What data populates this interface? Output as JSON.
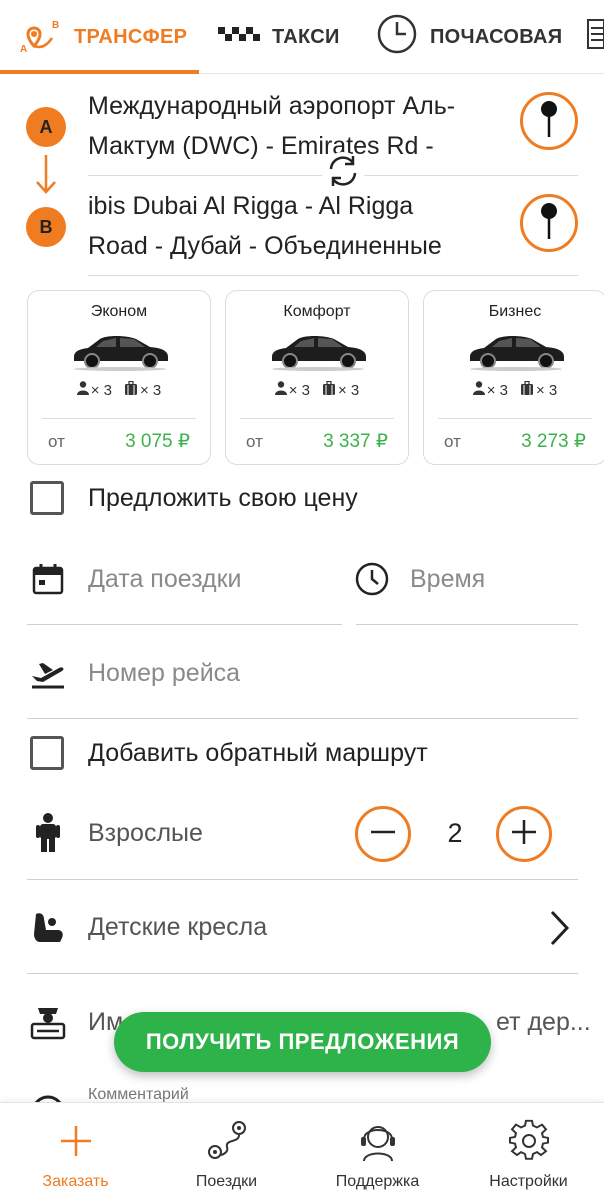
{
  "tabs": [
    {
      "label": "ТРАНСФЕР",
      "icon": "route-ab-icon",
      "active": true
    },
    {
      "label": "ТАКСИ",
      "icon": "checkered-taxi-icon",
      "active": false
    },
    {
      "label": "ПОЧАСОВАЯ",
      "icon": "clock-icon",
      "active": false
    }
  ],
  "route": {
    "from_marker": "A",
    "to_marker": "B",
    "from_line1": "Международный аэропорт Аль-",
    "from_line2": "Мактум (DWC) - Emirates Rd -",
    "to_line1": "ibis Dubai Al Rigga - Al Rigga",
    "to_line2": "Road - Дубай - Объединенные"
  },
  "cars": [
    {
      "name": "Эконом",
      "passengers": "× 3",
      "luggage": "× 3",
      "from": "от",
      "price": "3 075 ₽"
    },
    {
      "name": "Комфорт",
      "passengers": "× 3",
      "luggage": "× 3",
      "from": "от",
      "price": "3 337 ₽"
    },
    {
      "name": "Бизнес",
      "passengers": "× 3",
      "luggage": "× 3",
      "from": "от",
      "price": "3 273 ₽"
    }
  ],
  "form": {
    "offer_price_label": "Предложить свою цену",
    "date_placeholder": "Дата поездки",
    "time_placeholder": "Время",
    "flight_placeholder": "Номер рейса",
    "return_route_label": "Добавить обратный маршрут",
    "adults_label": "Взрослые",
    "adults_count": "2",
    "child_seats_label": "Детские кресла",
    "sign_partial_left": "Им",
    "sign_partial_right": "ет дер...",
    "comment_label": "Комментарий"
  },
  "cta": {
    "label": "ПОЛУЧИТЬ ПРЕДЛОЖЕНИЯ"
  },
  "bottom_nav": [
    {
      "label": "Заказать",
      "icon": "plus-icon",
      "active": true
    },
    {
      "label": "Поездки",
      "icon": "route-icon",
      "active": false
    },
    {
      "label": "Поддержка",
      "icon": "headset-icon",
      "active": false
    },
    {
      "label": "Настройки",
      "icon": "gear-icon",
      "active": false
    }
  ],
  "colors": {
    "accent": "#f07c22",
    "price": "#3cb24a",
    "cta": "#2db34a"
  }
}
